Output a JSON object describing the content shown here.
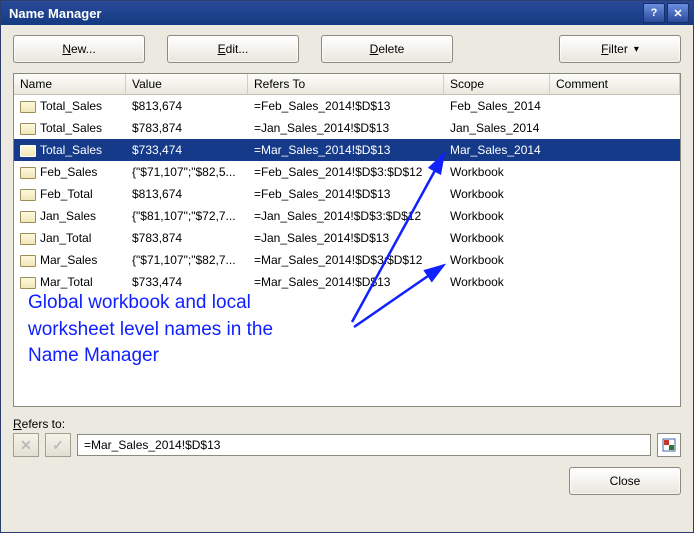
{
  "title": "Name Manager",
  "toolbar": {
    "new": {
      "pre": "",
      "u": "N",
      "post": "ew..."
    },
    "edit": {
      "pre": "",
      "u": "E",
      "post": "dit..."
    },
    "delete": {
      "pre": "",
      "u": "D",
      "post": "elete"
    },
    "filter": {
      "pre": "",
      "u": "F",
      "post": "ilter"
    }
  },
  "headers": {
    "name": "Name",
    "value": "Value",
    "refers": "Refers To",
    "scope": "Scope",
    "comment": "Comment"
  },
  "rows": [
    {
      "name": "Total_Sales",
      "value": "$813,674",
      "refers": "=Feb_Sales_2014!$D$13",
      "scope": "Feb_Sales_2014",
      "selected": false
    },
    {
      "name": "Total_Sales",
      "value": "$783,874",
      "refers": "=Jan_Sales_2014!$D$13",
      "scope": "Jan_Sales_2014",
      "selected": false
    },
    {
      "name": "Total_Sales",
      "value": "$733,474",
      "refers": "=Mar_Sales_2014!$D$13",
      "scope": "Mar_Sales_2014",
      "selected": true
    },
    {
      "name": "Feb_Sales",
      "value": "{\"$71,107\";\"$82,5...",
      "refers": "=Feb_Sales_2014!$D$3:$D$12",
      "scope": "Workbook",
      "selected": false
    },
    {
      "name": "Feb_Total",
      "value": "$813,674",
      "refers": "=Feb_Sales_2014!$D$13",
      "scope": "Workbook",
      "selected": false
    },
    {
      "name": "Jan_Sales",
      "value": "{\"$81,107\";\"$72,7...",
      "refers": "=Jan_Sales_2014!$D$3:$D$12",
      "scope": "Workbook",
      "selected": false
    },
    {
      "name": "Jan_Total",
      "value": "$783,874",
      "refers": "=Jan_Sales_2014!$D$13",
      "scope": "Workbook",
      "selected": false
    },
    {
      "name": "Mar_Sales",
      "value": "{\"$71,107\";\"$82,7...",
      "refers": "=Mar_Sales_2014!$D$3:$D$12",
      "scope": "Workbook",
      "selected": false
    },
    {
      "name": "Mar_Total",
      "value": "$733,474",
      "refers": "=Mar_Sales_2014!$D$13",
      "scope": "Workbook",
      "selected": false
    }
  ],
  "annotation": {
    "line1": "Global workbook and local",
    "line2": "worksheet level names in the",
    "line3": "Name Manager"
  },
  "refersto": {
    "label": "Refers to:",
    "value": "=Mar_Sales_2014!$D$13"
  },
  "close": "Close"
}
